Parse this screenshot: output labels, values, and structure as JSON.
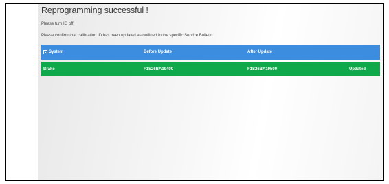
{
  "header": {
    "title": "Reprogramming successful !",
    "instruction_1": "Please turn IG off",
    "instruction_2": "Please confirm that calibration ID has been updated as outlined in the specific Service Bulletin."
  },
  "table": {
    "columns": [
      "System",
      "Before Update",
      "After Update",
      ""
    ],
    "rows": [
      {
        "system": "Brake",
        "before": "F1S26BA19400",
        "after": "F1S26BA19500",
        "status": "Updated"
      }
    ]
  },
  "colors": {
    "header_row": "#3c8ce0",
    "success_row": "#0fa84a"
  },
  "icons": {
    "expand": "collapse-toggle-icon"
  }
}
